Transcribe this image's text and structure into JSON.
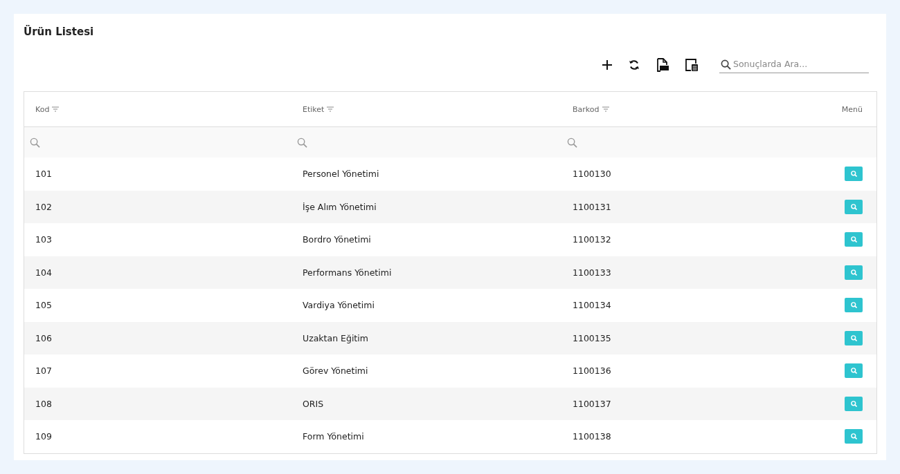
{
  "title": "Ürün Listesi",
  "search": {
    "placeholder": "Sonuçlarda Ara..."
  },
  "table": {
    "columns": [
      {
        "label": "Kod",
        "kind": "filterable"
      },
      {
        "label": "Etiket",
        "kind": "filterable"
      },
      {
        "label": "Barkod",
        "kind": "filterable"
      },
      {
        "label": "Menü",
        "kind": "actions"
      }
    ],
    "rows": [
      {
        "kod": "101",
        "etiket": "Personel Yönetimi",
        "barkod": "1100130"
      },
      {
        "kod": "102",
        "etiket": "İşe Alım Yönetimi",
        "barkod": "1100131"
      },
      {
        "kod": "103",
        "etiket": "Bordro Yönetimi",
        "barkod": "1100132"
      },
      {
        "kod": "104",
        "etiket": "Performans Yönetimi",
        "barkod": "1100133"
      },
      {
        "kod": "105",
        "etiket": "Vardiya Yönetimi",
        "barkod": "1100134"
      },
      {
        "kod": "106",
        "etiket": "Uzaktan Eğitim",
        "barkod": "1100135"
      },
      {
        "kod": "107",
        "etiket": "Görev Yönetimi",
        "barkod": "1100136"
      },
      {
        "kod": "108",
        "etiket": "ORIS",
        "barkod": "1100137"
      },
      {
        "kod": "109",
        "etiket": "Form Yönetimi",
        "barkod": "1100138"
      }
    ]
  }
}
